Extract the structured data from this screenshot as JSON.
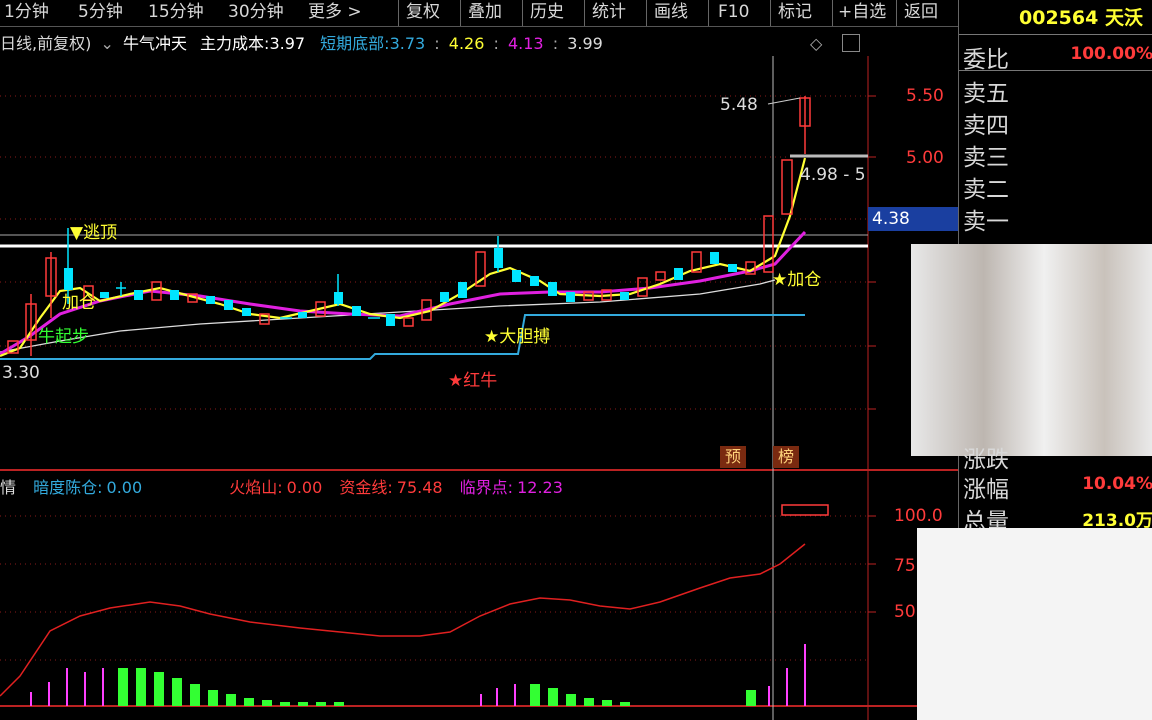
{
  "toolbar": {
    "periods": [
      "1分钟",
      "5分钟",
      "15分钟",
      "30分钟",
      "更多 >"
    ],
    "actions": [
      "复权",
      "叠加",
      "历史",
      "统计",
      "画线",
      "F10",
      "标记",
      "+自选",
      "返回"
    ]
  },
  "stock": {
    "code": "002564",
    "name": "天沃"
  },
  "info": {
    "period_label": "日线,前复权)",
    "indicator_name": "牛气冲天",
    "main_cost_label": "主力成本:",
    "main_cost_value": "3.97",
    "short_bottom_label": "短期底部:",
    "v1": "3.73",
    "v2": "4.26",
    "v3": "4.13",
    "v4": "3.99",
    "sep1": ":",
    "sep2": ":",
    "sep3": ":"
  },
  "price_axis": {
    "p1": "5.50",
    "p2": "5.00",
    "p3": "4.38"
  },
  "annotations": {
    "peak_price": "5.48",
    "range": "4.98 - 5",
    "low_price": "3.30",
    "escape_top": "▼逃顶",
    "add_pos_1": "加仓",
    "start": "牛起步",
    "bold": "★大胆搏",
    "red_bull": "★红牛",
    "add_pos_2": "★加仓",
    "tag_pre": "预",
    "tag_bang": "榜"
  },
  "indicator": {
    "prefix": "情",
    "name1": "暗度陈仓:",
    "val1": "0.00",
    "name2": "火焰山:",
    "val2": "0.00",
    "name3": "资金线:",
    "val3": "75.48",
    "name4": "临界点:",
    "val4": "12.23",
    "axis1": "100.0",
    "axis2": "75",
    "axis3": "50"
  },
  "right_panel": {
    "ratio_label": "委比",
    "ratio_value": "100.00%",
    "sell5": "卖五",
    "sell4": "卖四",
    "sell3": "卖三",
    "sell2": "卖二",
    "sell1": "卖一",
    "up_down": "涨跌",
    "change_label": "涨幅",
    "change_value": "10.04%",
    "volume_label": "总量",
    "volume_value": "213.0万"
  },
  "colors": {
    "up": "#ff3b3b",
    "down": "#00e5ff",
    "ma_yellow": "#ffff33",
    "ma_magenta": "#e020e0",
    "support": "#33aadd",
    "vol_up": "#ff40ff",
    "vol_green": "#33ff33"
  }
}
